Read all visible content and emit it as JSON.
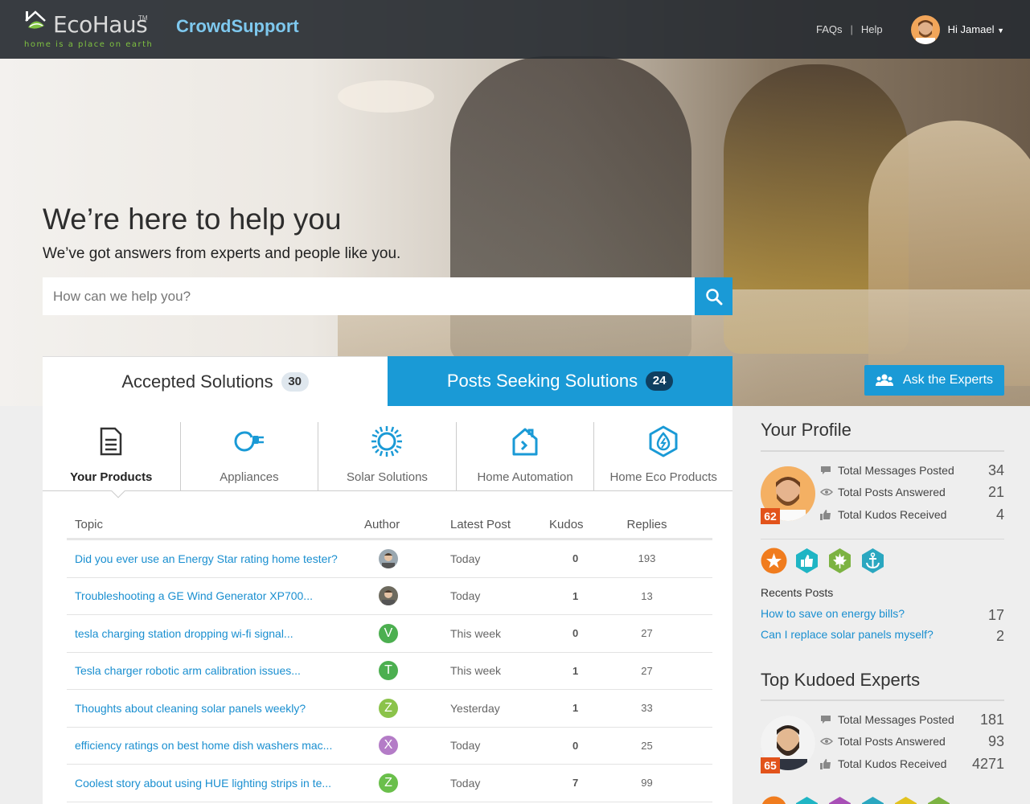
{
  "header": {
    "logo_word": "EcoHaus",
    "logo_tm": "TM",
    "logo_tagline": "home is a place on earth",
    "brand": "CrowdSupport",
    "links": [
      "FAQs",
      "Help"
    ],
    "greeting": "Hi Jamael"
  },
  "hero": {
    "title": "We’re here to help you",
    "subtitle": "We’ve got answers from experts and people like you.",
    "search_placeholder": "How can we help you?"
  },
  "tabs": [
    {
      "label": "Accepted Solutions",
      "count": "30",
      "active": true
    },
    {
      "label": "Posts Seeking Solutions",
      "count": "24",
      "active": false
    }
  ],
  "ask_button": "Ask the Experts",
  "categories": [
    {
      "label": "Your Products",
      "icon": "document-icon",
      "active": true
    },
    {
      "label": "Appliances",
      "icon": "plug-icon",
      "active": false
    },
    {
      "label": "Solar Solutions",
      "icon": "sun-icon",
      "active": false
    },
    {
      "label": "Home Automation",
      "icon": "house-icon",
      "active": false
    },
    {
      "label": "Home Eco Products",
      "icon": "eco-drop-icon",
      "active": false
    }
  ],
  "table": {
    "headers": {
      "topic": "Topic",
      "author": "Author",
      "latest": "Latest Post",
      "kudos": "Kudos",
      "replies": "Replies"
    },
    "rows": [
      {
        "topic": "Did you ever use an Energy Star rating home tester?",
        "author_initial": "",
        "author_color": "#9aa7b0",
        "latest": "Today",
        "kudos": "0",
        "replies": "193"
      },
      {
        "topic": "Troubleshooting a GE Wind Generator XP700...",
        "author_initial": "",
        "author_color": "#6d6a5e",
        "latest": "Today",
        "kudos": "1",
        "replies": "13"
      },
      {
        "topic": "tesla charging station dropping wi-fi signal...",
        "author_initial": "V",
        "author_color": "#4caf50",
        "latest": "This week",
        "kudos": "0",
        "replies": "27"
      },
      {
        "topic": "Tesla charger robotic arm calibration issues...",
        "author_initial": "T",
        "author_color": "#4caf50",
        "latest": "This week",
        "kudos": "1",
        "replies": "27"
      },
      {
        "topic": "Thoughts about cleaning solar panels weekly?",
        "author_initial": "Z",
        "author_color": "#8bc34a",
        "latest": "Yesterday",
        "kudos": "1",
        "replies": "33"
      },
      {
        "topic": "efficiency ratings on best home dish washers mac...",
        "author_initial": "X",
        "author_color": "#b47cc7",
        "latest": "Today",
        "kudos": "0",
        "replies": "25"
      },
      {
        "topic": "Coolest story about using HUE lighting strips in te...",
        "author_initial": "Z",
        "author_color": "#6abf4b",
        "latest": "Today",
        "kudos": "7",
        "replies": "99"
      }
    ]
  },
  "profile": {
    "title": "Your Profile",
    "rank": "62",
    "stats": [
      {
        "label": "Total Messages Posted",
        "value": "34",
        "icon": "speech-bubble-icon"
      },
      {
        "label": "Total Posts Answered",
        "value": "21",
        "icon": "eye-icon"
      },
      {
        "label": "Total Kudos Received",
        "value": "4",
        "icon": "thumbs-up-icon"
      }
    ],
    "badges": [
      {
        "icon": "star-badge-icon",
        "color": "#f07c1e"
      },
      {
        "icon": "thumbs-up-badge-icon",
        "color": "#1fb5c4"
      },
      {
        "icon": "leaf-badge-icon",
        "color": "#7cb342"
      },
      {
        "icon": "anchor-badge-icon",
        "color": "#2aa7c0"
      }
    ],
    "recent_head": "Recents Posts",
    "recent_posts": [
      {
        "title": "How to save on energy bills?",
        "count": "17"
      },
      {
        "title": "Can I replace solar panels myself?",
        "count": "2"
      }
    ]
  },
  "experts": {
    "title": "Top Kudoed Experts",
    "rank": "65",
    "stats": [
      {
        "label": "Total Messages Posted",
        "value": "181"
      },
      {
        "label": "Total Posts Answered",
        "value": "93"
      },
      {
        "label": "Total Kudos Received",
        "value": "4271"
      }
    ],
    "badge_colors": [
      "#f07c1e",
      "#1fb5c4",
      "#a84fb6",
      "#2aa7c0",
      "#e2c21f",
      "#7cb342"
    ]
  },
  "colors": {
    "accent": "#1a9ad6",
    "link": "#1a8fd0",
    "rank": "#e2531b"
  }
}
